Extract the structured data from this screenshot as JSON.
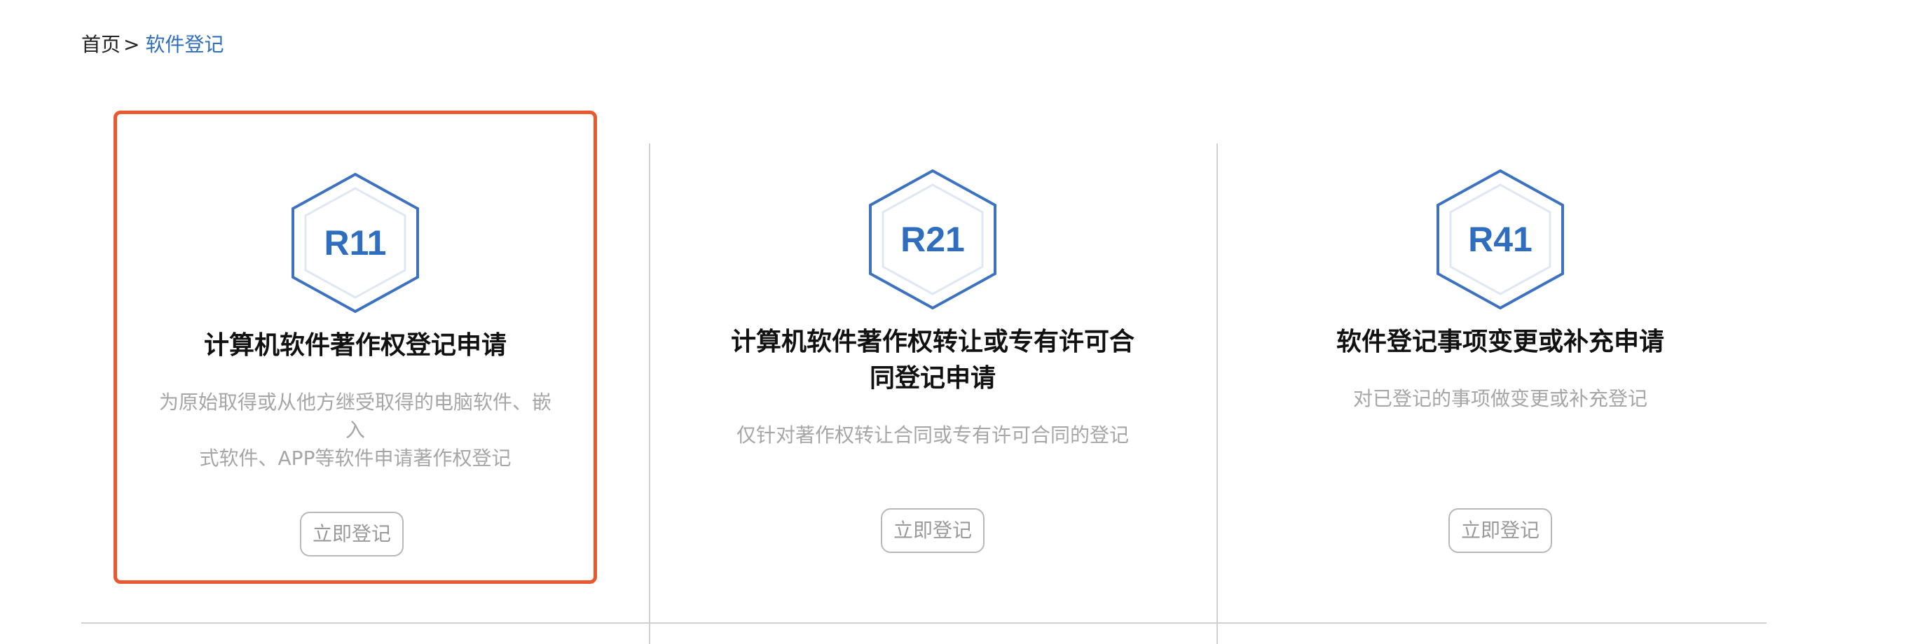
{
  "breadcrumb": {
    "home": "首页",
    "separator": ">",
    "current": "软件登记"
  },
  "colors": {
    "accent": "#2f6dbf",
    "selected_border": "#e85a2e"
  },
  "cards": [
    {
      "code": "R11",
      "icon": "hexagon-badge-icon",
      "title": "计算机软件著作权登记申请",
      "description_lines": [
        "为原始取得或从他方继受取得的电脑软件、嵌入",
        "式软件、APP等软件申请著作权登记"
      ],
      "button": "立即登记",
      "selected": true
    },
    {
      "code": "R21",
      "icon": "hexagon-badge-icon",
      "title_lines": [
        "计算机软件著作权转让或专有许可合",
        "同登记申请"
      ],
      "description": "仅针对著作权转让合同或专有许可合同的登记",
      "button": "立即登记",
      "selected": false
    },
    {
      "code": "R41",
      "icon": "hexagon-badge-icon",
      "title": "软件登记事项变更或补充申请",
      "description": "对已登记的事项做变更或补充登记",
      "button": "立即登记",
      "selected": false
    }
  ]
}
